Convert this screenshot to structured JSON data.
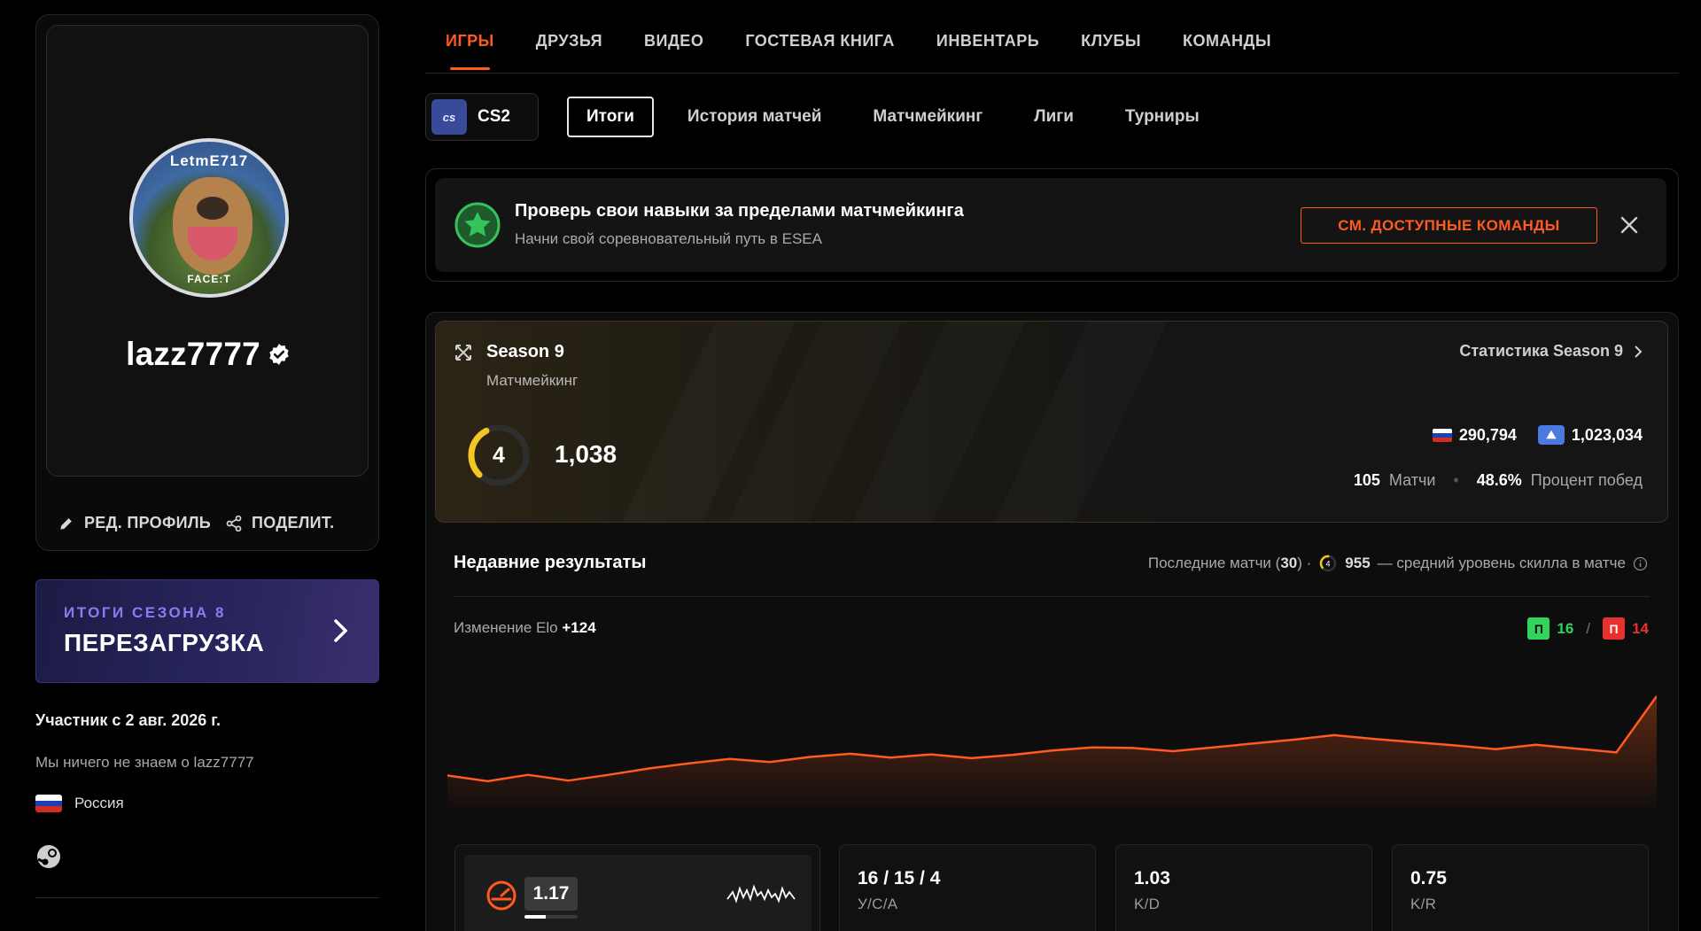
{
  "profile": {
    "username": "lazz7777",
    "avatar_ring_top": "LetmE717",
    "avatar_ring_bottom": "FACE:T",
    "edit_label": "РЕД. ПРОФИЛЬ",
    "share_label": "ПОДЕЛИТ.",
    "member_since": "Участник с 2 авг. 2026 г.",
    "about": "Мы ничего не знаем о lazz7777",
    "country": "Россия"
  },
  "season_banner": {
    "subtitle": "ИТОГИ СЕЗОНА 8",
    "title": "ПЕРЕЗАГРУЗКА"
  },
  "main_tabs": [
    {
      "label": "ИГРЫ",
      "active": true
    },
    {
      "label": "ДРУЗЬЯ",
      "active": false
    },
    {
      "label": "ВИДЕО",
      "active": false
    },
    {
      "label": "ГОСТЕВАЯ КНИГА",
      "active": false
    },
    {
      "label": "ИНВЕНТАРЬ",
      "active": false
    },
    {
      "label": "КЛУБЫ",
      "active": false
    },
    {
      "label": "КОМАНДЫ",
      "active": false
    }
  ],
  "game": {
    "logo": "cs",
    "name": "CS2"
  },
  "sub_tabs": [
    {
      "label": "Итоги",
      "active": true
    },
    {
      "label": "История матчей",
      "active": false
    },
    {
      "label": "Матчмейкинг",
      "active": false
    },
    {
      "label": "Лиги",
      "active": false
    },
    {
      "label": "Турниры",
      "active": false
    }
  ],
  "promo": {
    "title": "Проверь свои навыки за пределами матчмейкинга",
    "subtitle": "Начни свой соревновательный путь в ESEA",
    "button": "СМ. ДОСТУПНЫЕ КОМАНДЫ"
  },
  "season": {
    "name": "Season 9",
    "mode": "Матчмейкинг",
    "stats_link": "Статистика Season 9",
    "level": "4",
    "level_progress": 0.4,
    "elo": "1,038",
    "country_rank": "290,794",
    "region_rank": "1,023,034",
    "matches": "105",
    "matches_label": "Матчи",
    "winrate": "48.6%",
    "winrate_label": "Процент побед"
  },
  "recent": {
    "title": "Недавние результаты",
    "last_matches_prefix": "Последние матчи (",
    "last_matches_count": "30",
    "last_matches_suffix": ") ·",
    "avg_level": "4",
    "avg_elo": "955",
    "avg_desc": "— средний уровень скилла в матче",
    "elo_change_label": "Изменение Elo",
    "elo_change": "+124",
    "win_letter": "П",
    "wins": "16",
    "loss_letter": "П",
    "losses": "14",
    "separator": "/"
  },
  "chart_data": {
    "type": "area",
    "title": "",
    "xlabel": "",
    "ylabel": "",
    "series": [
      {
        "values": [
          914,
          905,
          915,
          906,
          915,
          925,
          933,
          940,
          935,
          943,
          948,
          942,
          947,
          941,
          946,
          953,
          958,
          957,
          952,
          958,
          964,
          970,
          977,
          971,
          966,
          961,
          955,
          962,
          956,
          950,
          1038
        ]
      }
    ],
    "ylim": [
      880,
      1060
    ],
    "grid": false,
    "colors": {
      "line": "#ff5a1f"
    }
  },
  "stats": {
    "rating": "1.17",
    "rating_progress": 0.4,
    "usa": "16 / 15 / 4",
    "usa_label": "У/С/А",
    "kd": "1.03",
    "kd_label": "K/D",
    "kr": "0.75",
    "kr_label": "K/R"
  },
  "colors": {
    "accent": "#ff5a1f",
    "win": "#32d35a",
    "loss": "#e8312f",
    "level_gauge": "#f3c623",
    "banner_sub": "#8b7cf0"
  },
  "icons": {
    "edit": "pencil-icon",
    "share": "share-icon",
    "verified": "verified-badge-icon",
    "steam": "steam-icon",
    "close": "close-icon",
    "chevron": "chevron-right-icon",
    "promo": "star-badge-icon",
    "season": "shuffle-icon",
    "info": "info-icon"
  }
}
